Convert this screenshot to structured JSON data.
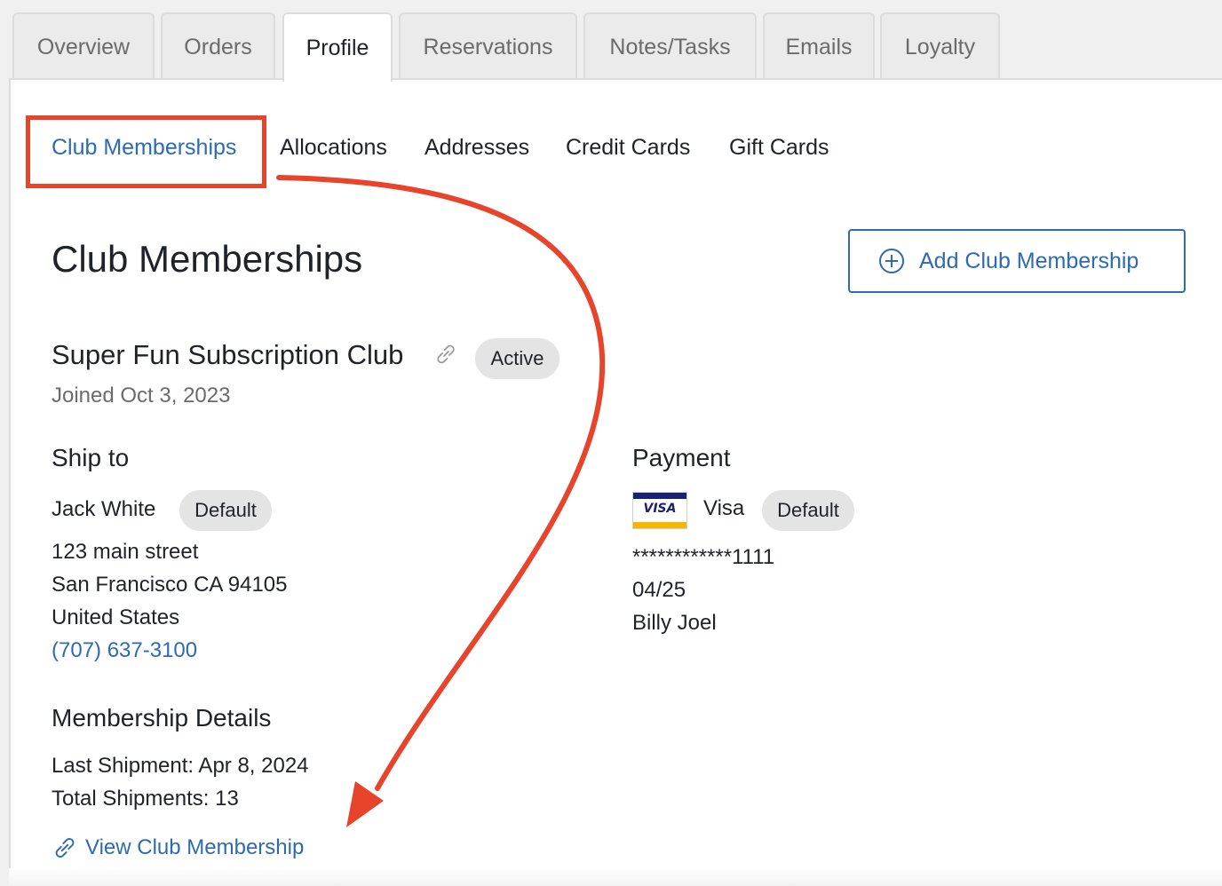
{
  "tabs": [
    {
      "label": "Overview",
      "active": false
    },
    {
      "label": "Orders",
      "active": false
    },
    {
      "label": "Profile",
      "active": true
    },
    {
      "label": "Reservations",
      "active": false
    },
    {
      "label": "Notes/Tasks",
      "active": false
    },
    {
      "label": "Emails",
      "active": false
    },
    {
      "label": "Loyalty",
      "active": false
    }
  ],
  "subnav": {
    "items": [
      {
        "label": "Club Memberships",
        "active": true
      },
      {
        "label": "Allocations",
        "active": false
      },
      {
        "label": "Addresses",
        "active": false
      },
      {
        "label": "Credit Cards",
        "active": false
      },
      {
        "label": "Gift Cards",
        "active": false
      }
    ]
  },
  "page": {
    "title": "Club Memberships",
    "add_button_label": "Add Club Membership"
  },
  "membership": {
    "club_name": "Super Fun Subscription Club",
    "status": "Active",
    "joined": "Joined Oct 3, 2023",
    "ship_to": {
      "heading": "Ship to",
      "name": "Jack White",
      "badge": "Default",
      "street": "123 main street",
      "city_line": "San Francisco CA 94105",
      "country": "United States",
      "phone": "(707) 637-3100"
    },
    "payment": {
      "heading": "Payment",
      "card_brand_logo": "VISA",
      "card_type": "Visa",
      "badge": "Default",
      "masked_number": "************1111",
      "expiry": "04/25",
      "cardholder": "Billy Joel"
    },
    "details": {
      "heading": "Membership Details",
      "last_shipment": "Last Shipment: Apr 8, 2024",
      "total_shipments": "Total Shipments: 13",
      "view_link": "View Club Membership"
    }
  },
  "annotation": {
    "color": "#e8442b",
    "icons": [
      "plus-circle-icon",
      "link-icon",
      "visa-card-icon"
    ]
  }
}
